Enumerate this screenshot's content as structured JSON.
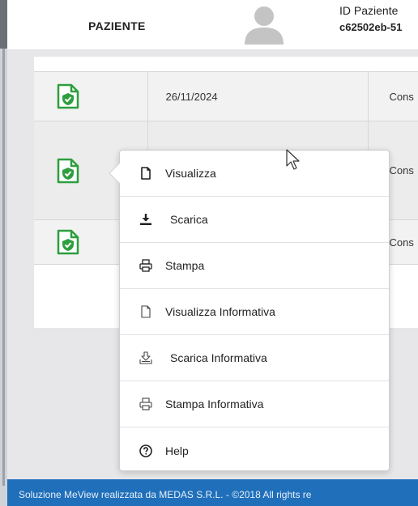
{
  "header": {
    "title": "PAZIENTE",
    "id_label": "ID Paziente",
    "id_value": "c62502eb-51"
  },
  "table": {
    "rows": [
      {
        "date": "26/11/2024",
        "type": "Cons"
      },
      {
        "date": "",
        "type": "Cons"
      },
      {
        "date": "",
        "type": "Cons"
      }
    ]
  },
  "menu": {
    "items": [
      {
        "label": "Visualizza",
        "icon": "file-icon"
      },
      {
        "label": "Scarica",
        "icon": "download-icon"
      },
      {
        "label": "Stampa",
        "icon": "print-icon"
      },
      {
        "label": "Visualizza Informativa",
        "icon": "file-icon"
      },
      {
        "label": "Scarica Informativa",
        "icon": "download-icon"
      },
      {
        "label": "Stampa Informativa",
        "icon": "print-icon"
      },
      {
        "label": "Help",
        "icon": "help-icon"
      }
    ]
  },
  "footer": {
    "text": "Soluzione MeView realizzata da MEDAS S.R.L. - ©2018 All rights re"
  },
  "colors": {
    "footer_bg": "#1f6fba",
    "doc_icon_green": "#2e9e3f"
  }
}
